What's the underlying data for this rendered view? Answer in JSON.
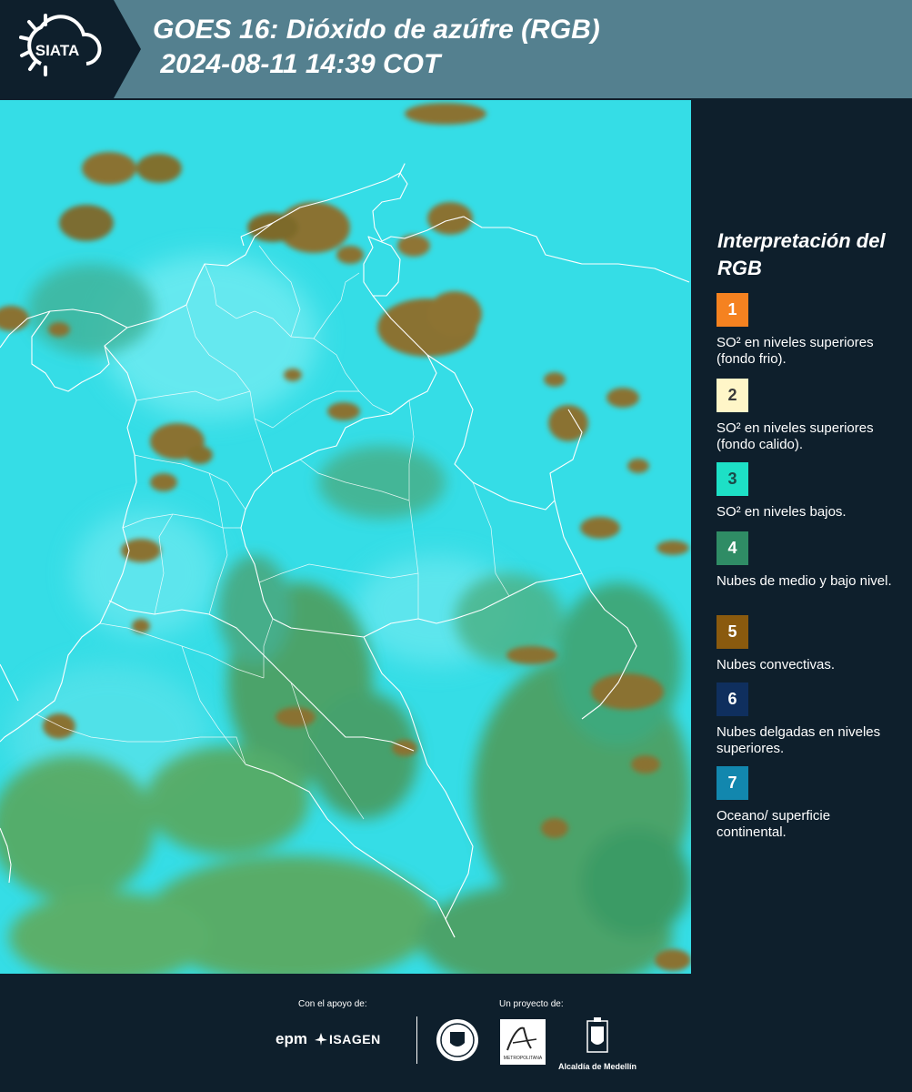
{
  "header": {
    "logo_text": "SIATA",
    "title": "GOES 16: Dióxido de azúfre (RGB)\n 2024-08-11 14:39 COT"
  },
  "map": {
    "background_color": "#35dde6",
    "cloud_color": "#8a7230",
    "low_cloud_color": "#4f9a54",
    "border_color": "#ffffff"
  },
  "legend": {
    "title": "Interpretación del RGB",
    "items": [
      {
        "number": "1",
        "color": "#f58220",
        "number_color": "#ffffff",
        "text": "SO² en niveles superiores (fondo frio)."
      },
      {
        "number": "2",
        "color": "#fff6c8",
        "number_color": "#3a3a3a",
        "text": "SO² en niveles superiores (fondo calido)."
      },
      {
        "number": "3",
        "color": "#1de0c6",
        "number_color": "#1a4a48",
        "text": "SO² en niveles bajos."
      },
      {
        "number": "4",
        "color": "#2f8c65",
        "number_color": "#ffffff",
        "text": "Nubes de medio y bajo nivel."
      },
      {
        "number": "5",
        "color": "#8a5a0e",
        "number_color": "#ffffff",
        "text": "Nubes convectivas."
      },
      {
        "number": "6",
        "color": "#0f2f5e",
        "number_color": "#ffffff",
        "text": "Nubes delgadas en niveles superiores."
      },
      {
        "number": "7",
        "color": "#1287ae",
        "number_color": "#ffffff",
        "text": "Oceano/ superficie continental."
      }
    ]
  },
  "footer": {
    "support_label": "Con el apoyo de:",
    "project_label": "Un proyecto de:",
    "epm": "epm",
    "isagen": "ISAGEN",
    "area_text": "METROPOLITANA",
    "alcaldia": "Alcaldía de Medellín"
  }
}
